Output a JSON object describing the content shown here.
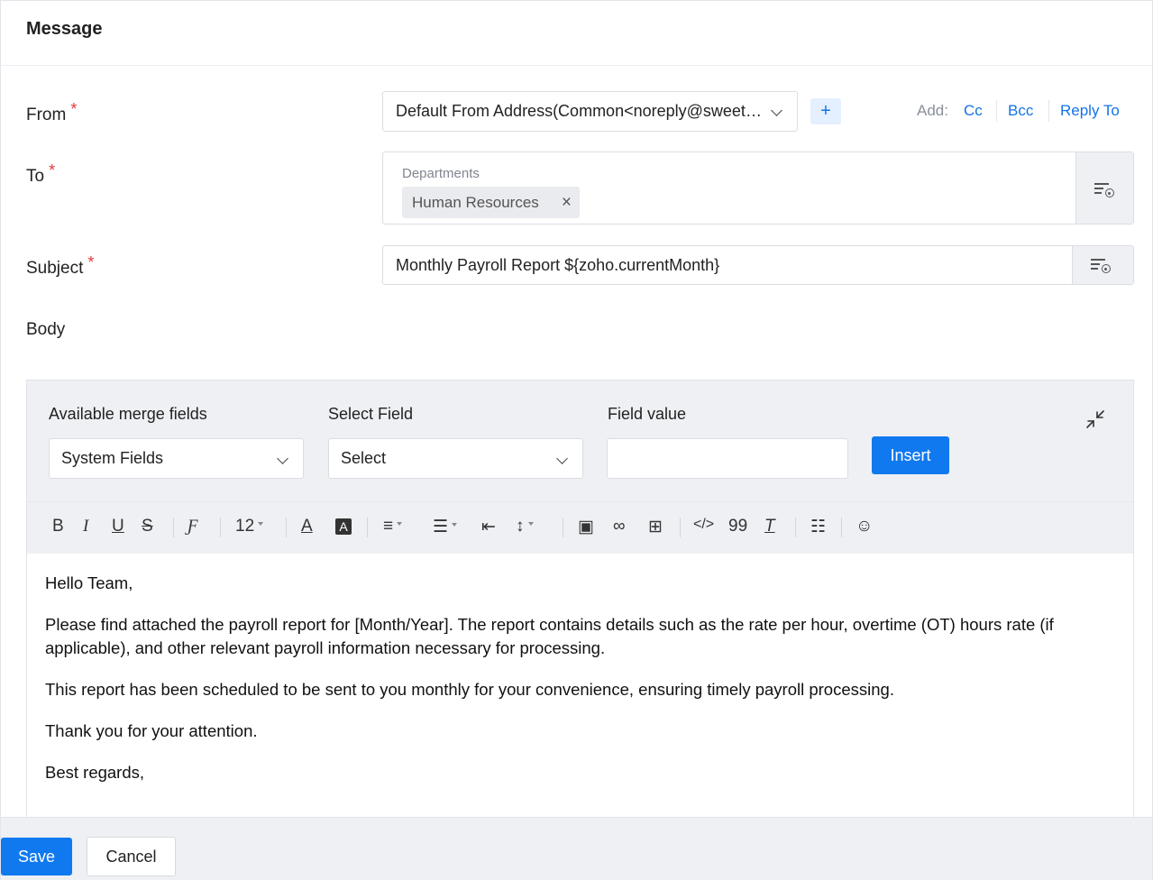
{
  "header": {
    "title": "Message"
  },
  "form": {
    "from": {
      "label": "From",
      "required_mark": "*",
      "value": "Default From Address(Common<noreply@sweetbites.com>)",
      "add_label": "Add:",
      "cc": "Cc",
      "bcc": "Bcc",
      "reply_to": "Reply To",
      "plus": "+"
    },
    "to": {
      "label": "To",
      "required_mark": "*",
      "group_label": "Departments",
      "chip": "Human Resources",
      "chip_remove": "×"
    },
    "subject": {
      "label": "Subject",
      "required_mark": "*",
      "value": "Monthly Payroll Report ${zoho.currentMonth}"
    },
    "body": {
      "label": "Body"
    }
  },
  "merge": {
    "available_label": "Available merge fields",
    "available_value": "System Fields",
    "select_field_label": "Select Field",
    "select_field_value": "Select",
    "field_value_label": "Field value",
    "field_value": "",
    "insert": "Insert"
  },
  "toolbar": {
    "bold": "B",
    "italic": "I",
    "underline": "U",
    "strike": "S",
    "font_size": "12",
    "code": "</>",
    "quote": "99"
  },
  "body_text": {
    "p1": "Hello Team,",
    "p2": "Please find attached the payroll report for [Month/Year]. The report contains details such as the rate per hour, overtime (OT) hours rate (if applicable), and other relevant payroll information necessary for processing.",
    "p3": "This report has been scheduled to be sent to you monthly for your convenience, ensuring timely payroll processing.",
    "p4": "Thank you for your attention.",
    "p5": "Best regards,"
  },
  "footer": {
    "save": "Save",
    "cancel": "Cancel"
  },
  "colors": {
    "accent": "#1079ef",
    "required": "#e5383b",
    "panel": "#eef0f4"
  }
}
